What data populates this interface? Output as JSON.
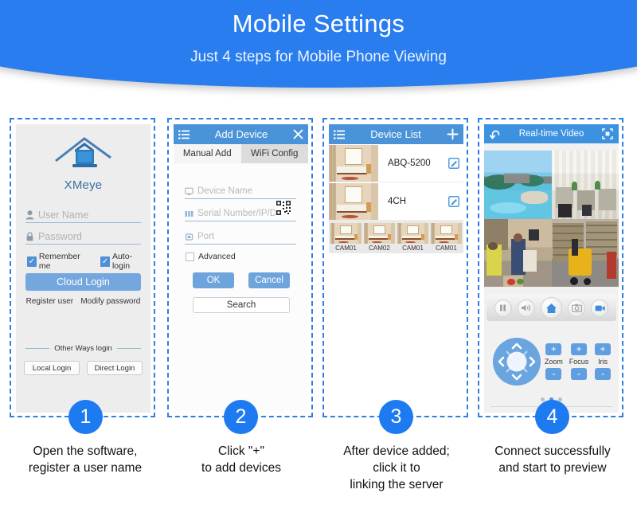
{
  "header": {
    "title": "Mobile Settings",
    "subtitle": "Just 4 steps for Mobile Phone Viewing",
    "bg_color": "#2a7dee"
  },
  "steps": [
    {
      "number": "1",
      "caption_line1": "Open the software,",
      "caption_line2": "register a user name"
    },
    {
      "number": "2",
      "caption_line1": "Click \"+\"",
      "caption_line2": "to add devices"
    },
    {
      "number": "3",
      "caption_line1": "After device added;",
      "caption_line2": "click it to",
      "caption_line3": "linking the server"
    },
    {
      "number": "4",
      "caption_line1": "Connect successfully",
      "caption_line2": "and start to preview"
    }
  ],
  "panel1": {
    "logo_text": "XMeye",
    "logo_icon": "house-logo-icon",
    "username_placeholder": "User Name",
    "username_icon": "person-icon",
    "password_placeholder": "Password",
    "password_icon": "lock-icon",
    "remember_me_label": "Remember me",
    "auto_login_label": "Auto-login",
    "cloud_login_label": "Cloud Login",
    "register_user_label": "Register user",
    "modify_password_label": "Modify password",
    "other_ways_label": "Other Ways login",
    "local_login_label": "Local Login",
    "direct_login_label": "Direct Login"
  },
  "panel2": {
    "title": "Add Device",
    "menu_icon": "hamburger-menu-icon",
    "close_icon": "close-icon",
    "tab_manual": "Manual Add",
    "tab_wifi": "WiFi Config",
    "device_name_placeholder": "Device Name",
    "device_name_icon": "monitor-icon",
    "serial_placeholder": "Serial Number/IP/Do",
    "serial_icon": "grid-icon",
    "qr_icon": "qr-code-icon",
    "port_placeholder": "Port",
    "port_icon": "port-icon",
    "advanced_label": "Advanced",
    "ok_label": "OK",
    "cancel_label": "Cancel",
    "search_label": "Search"
  },
  "panel3": {
    "title": "Device List",
    "menu_icon": "hamburger-menu-icon",
    "add_icon": "plus-icon",
    "devices": [
      {
        "name": "ABQ-5200",
        "edit_icon": "edit-icon"
      },
      {
        "name": "4CH",
        "edit_icon": "edit-icon"
      }
    ],
    "channels": [
      "CAM01",
      "CAM02",
      "CAM01",
      "CAM01"
    ]
  },
  "panel4": {
    "title": "Real-time Video",
    "back_icon": "back-arrow-icon",
    "fullscreen_icon": "fullscreen-icon",
    "video_cells": [
      "resort-pool-scene",
      "office-scene",
      "supermarket-scene",
      "warehouse-forklift-scene"
    ],
    "controls": [
      {
        "icon": "pause-icon",
        "active": false
      },
      {
        "icon": "speaker-icon",
        "active": false
      },
      {
        "icon": "home-icon",
        "active": true
      },
      {
        "icon": "camera-snapshot-icon",
        "active": false
      },
      {
        "icon": "video-record-icon",
        "active": true
      }
    ],
    "ptz_icon": "dpad-icon",
    "lens_controls": [
      {
        "label": "Zoom",
        "plus": "+",
        "minus": "-"
      },
      {
        "label": "Focus",
        "plus": "+",
        "minus": "-"
      },
      {
        "label": "Iris",
        "plus": "+",
        "minus": "-"
      }
    ],
    "page_dots": 3,
    "active_dot": 1
  }
}
